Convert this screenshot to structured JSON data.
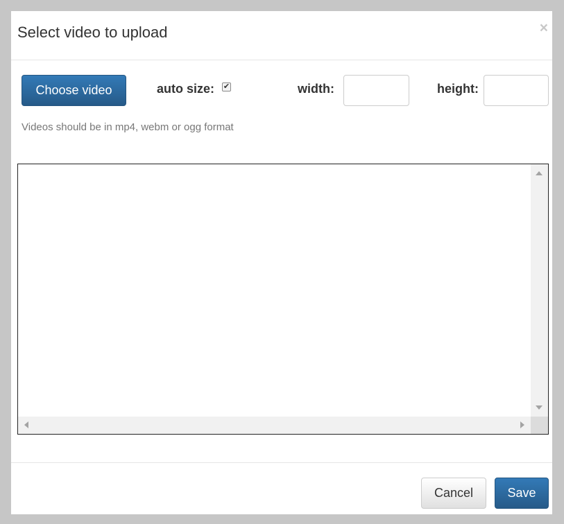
{
  "dialog": {
    "title": "Select video to upload",
    "close_glyph": "×"
  },
  "controls": {
    "choose_video_label": "Choose video",
    "auto_size_label": "auto size:",
    "auto_size_checked": true,
    "auto_size_check_glyph": "✔",
    "width_label": "width:",
    "width_value": "",
    "height_label": "height:",
    "height_value": ""
  },
  "hint": "Videos should be in mp4, webm or ogg format",
  "footer": {
    "cancel_label": "Cancel",
    "save_label": "Save"
  },
  "colors": {
    "primary": "#337ab7",
    "primary_dark": "#265a88",
    "backdrop": "#c6c6c6"
  }
}
